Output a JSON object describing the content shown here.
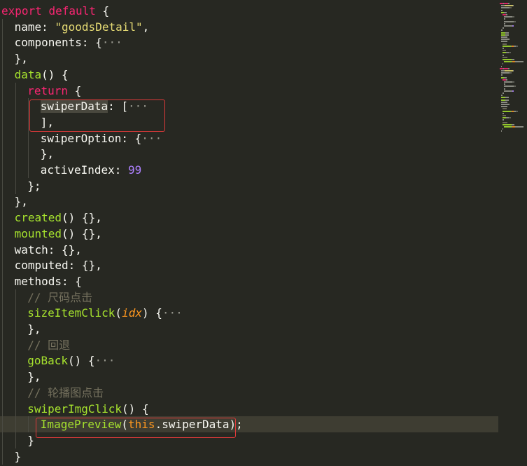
{
  "editor": {
    "theme_colors": {
      "background": "#272822",
      "keyword": "#f92672",
      "function": "#a6e22e",
      "string": "#e6db74",
      "number": "#ae81ff",
      "comment": "#75715e",
      "parameter": "#fd971f",
      "annotation_box": "#e03a3a"
    },
    "current_line": 26,
    "fold_marker": "···",
    "lines": [
      {
        "indent": 0,
        "tokens": [
          [
            "kw",
            "export"
          ],
          [
            "plain",
            " "
          ],
          [
            "kw",
            "default"
          ],
          [
            "plain",
            " {"
          ]
        ]
      },
      {
        "indent": 1,
        "tokens": [
          [
            "plain",
            "name: "
          ],
          [
            "str",
            "\"goodsDetail\""
          ],
          [
            "plain",
            ","
          ]
        ]
      },
      {
        "indent": 1,
        "tokens": [
          [
            "plain",
            "components: {"
          ],
          [
            "fold",
            "···"
          ]
        ]
      },
      {
        "indent": 1,
        "tokens": [
          [
            "plain",
            "},"
          ]
        ]
      },
      {
        "indent": 1,
        "tokens": [
          [
            "fn",
            "data"
          ],
          [
            "plain",
            "() {"
          ]
        ]
      },
      {
        "indent": 2,
        "tokens": [
          [
            "kw",
            "return"
          ],
          [
            "plain",
            " {"
          ]
        ]
      },
      {
        "indent": 3,
        "tokens": [
          [
            "sel",
            "swiperData"
          ],
          [
            "plain",
            ": ["
          ],
          [
            "fold",
            "···"
          ]
        ]
      },
      {
        "indent": 3,
        "tokens": [
          [
            "plain",
            "],"
          ]
        ]
      },
      {
        "indent": 3,
        "tokens": [
          [
            "plain",
            "swiperOption: {"
          ],
          [
            "fold",
            "···"
          ]
        ]
      },
      {
        "indent": 3,
        "tokens": [
          [
            "plain",
            "},"
          ]
        ]
      },
      {
        "indent": 3,
        "tokens": [
          [
            "plain",
            "activeIndex: "
          ],
          [
            "num",
            "99"
          ]
        ]
      },
      {
        "indent": 2,
        "tokens": [
          [
            "plain",
            "};"
          ]
        ]
      },
      {
        "indent": 1,
        "tokens": [
          [
            "plain",
            "},"
          ]
        ]
      },
      {
        "indent": 1,
        "tokens": [
          [
            "fn",
            "created"
          ],
          [
            "plain",
            "() {},"
          ]
        ]
      },
      {
        "indent": 1,
        "tokens": [
          [
            "fn",
            "mounted"
          ],
          [
            "plain",
            "() {},"
          ]
        ]
      },
      {
        "indent": 1,
        "tokens": [
          [
            "plain",
            "watch: {},"
          ]
        ]
      },
      {
        "indent": 1,
        "tokens": [
          [
            "plain",
            "computed: {},"
          ]
        ]
      },
      {
        "indent": 1,
        "tokens": [
          [
            "plain",
            "methods: {"
          ]
        ]
      },
      {
        "indent": 2,
        "tokens": [
          [
            "cm",
            "// 尺码点击"
          ]
        ]
      },
      {
        "indent": 2,
        "tokens": [
          [
            "fn",
            "sizeItemClick"
          ],
          [
            "plain",
            "("
          ],
          [
            "param",
            "idx"
          ],
          [
            "plain",
            ") {"
          ],
          [
            "fold",
            "···"
          ]
        ]
      },
      {
        "indent": 2,
        "tokens": [
          [
            "plain",
            "},"
          ]
        ]
      },
      {
        "indent": 2,
        "tokens": [
          [
            "cm",
            "// 回退"
          ]
        ]
      },
      {
        "indent": 2,
        "tokens": [
          [
            "fn",
            "goBack"
          ],
          [
            "plain",
            "() {"
          ],
          [
            "fold",
            "···"
          ]
        ]
      },
      {
        "indent": 2,
        "tokens": [
          [
            "plain",
            "},"
          ]
        ]
      },
      {
        "indent": 2,
        "tokens": [
          [
            "cm",
            "// 轮播图点击"
          ]
        ]
      },
      {
        "indent": 2,
        "tokens": [
          [
            "fn",
            "swiperImgClick"
          ],
          [
            "plain",
            "() {"
          ]
        ]
      },
      {
        "indent": 3,
        "tokens": [
          [
            "fn",
            "ImagePreview"
          ],
          [
            "plain",
            "("
          ],
          [
            "this",
            "this"
          ],
          [
            "plain",
            ".swiperData);"
          ]
        ]
      },
      {
        "indent": 2,
        "tokens": [
          [
            "plain",
            "}"
          ]
        ]
      },
      {
        "indent": 1,
        "tokens": [
          [
            "plain",
            "}"
          ]
        ]
      }
    ]
  }
}
